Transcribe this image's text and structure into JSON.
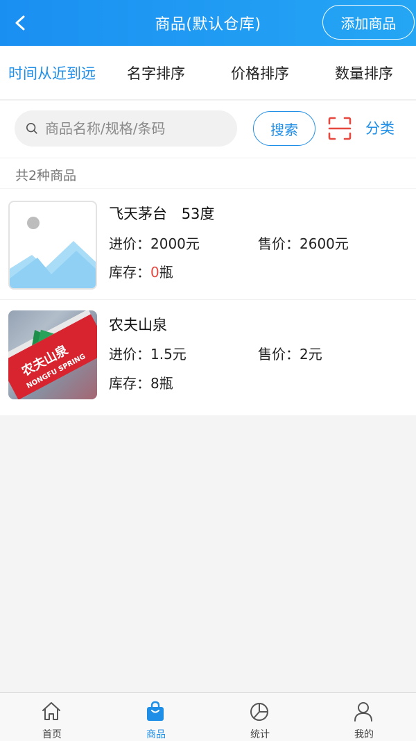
{
  "header": {
    "title": "商品(默认仓库)",
    "add_label": "添加商品"
  },
  "sort_tabs": [
    {
      "label": "时间从近到远",
      "active": true
    },
    {
      "label": "名字排序"
    },
    {
      "label": "价格排序"
    },
    {
      "label": "数量排序"
    }
  ],
  "search": {
    "placeholder": "商品名称/规格/条码",
    "button": "搜索",
    "category": "分类"
  },
  "count_text": "共2种商品",
  "products": [
    {
      "name": "飞天茅台",
      "spec": "53度",
      "buy_label": "进价：",
      "buy_price": "2000元",
      "sell_label": "售价：",
      "sell_price": "2600元",
      "stock_label": "库存：",
      "stock_qty": "0",
      "stock_unit": "瓶",
      "image": "placeholder-image-icon"
    },
    {
      "name": "农夫山泉",
      "buy_label": "进价：",
      "buy_price": "1.5元",
      "sell_label": "售价：",
      "sell_price": "2元",
      "stock_label": "库存：",
      "stock_qty": "8",
      "stock_unit": "瓶",
      "image": "water-bottle-photo",
      "image_text": "农夫山泉",
      "image_subtext": "NONGFU SPRING"
    }
  ],
  "tabbar": [
    {
      "label": "首页",
      "icon": "home-icon"
    },
    {
      "label": "商品",
      "icon": "shopping-bag-icon",
      "active": true
    },
    {
      "label": "统计",
      "icon": "pie-chart-icon"
    },
    {
      "label": "我的",
      "icon": "user-icon"
    }
  ],
  "colors": {
    "primary": "#1f8ee6",
    "header_start": "#1a8ff2",
    "header_end": "#25a6f4",
    "warning": "#e5483f"
  }
}
